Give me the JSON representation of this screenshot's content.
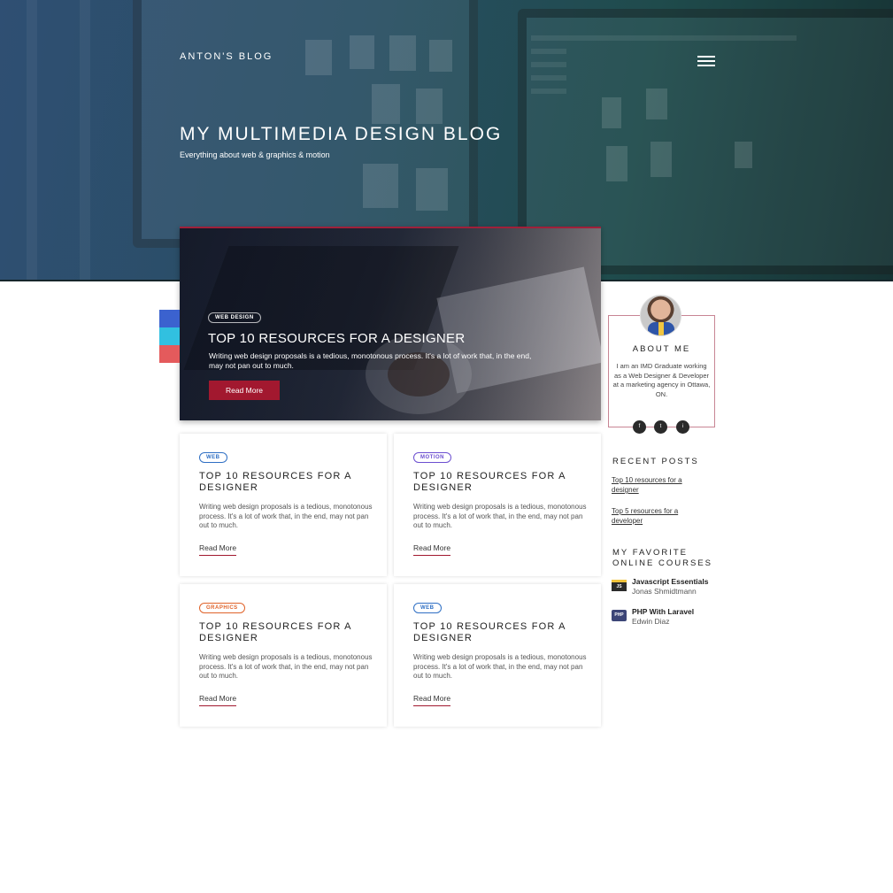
{
  "header": {
    "brand": "ANTON'S BLOG",
    "title": "MY MULTIMEDIA DESIGN BLOG",
    "subtitle": "Everything about web & graphics & motion"
  },
  "featured": {
    "tag": "WEB DESIGN",
    "title": "TOP 10 RESOURCES FOR A DESIGNER",
    "excerpt": "Writing web design proposals is a tedious, monotonous process. It's a lot of work that, in the end, may not pan out to much.",
    "button": "Read More"
  },
  "posts": [
    {
      "tag": "WEB",
      "tag_color": "#2f6fc4",
      "title": "TOP 10 RESOURCES FOR A DESIGNER",
      "excerpt": "Writing web design proposals is a tedious, monotonous process. It's a lot of work that, in the end, may not pan out to much.",
      "link": "Read More"
    },
    {
      "tag": "MOTION",
      "tag_color": "#6c4fd0",
      "title": "TOP 10 RESOURCES FOR A DESIGNER",
      "excerpt": "Writing web design proposals is a tedious, monotonous process. It's a lot of work that, in the end, may not pan out to much.",
      "link": "Read More"
    },
    {
      "tag": "GRAPHICS",
      "tag_color": "#e0632a",
      "title": "TOP 10 RESOURCES FOR A DESIGNER",
      "excerpt": "Writing web design proposals is a tedious, monotonous process. It's a lot of work that, in the end, may not pan out to much.",
      "link": "Read More"
    },
    {
      "tag": "WEB",
      "tag_color": "#2f6fc4",
      "title": "TOP 10 RESOURCES FOR A DESIGNER",
      "excerpt": "Writing web design proposals is a tedious, monotonous process. It's a lot of work that, in the end, may not pan out to much.",
      "link": "Read More"
    }
  ],
  "share": [
    {
      "icon": "facebook-icon",
      "color": "#3b62cf"
    },
    {
      "icon": "twitter-icon",
      "color": "#31c0e0"
    },
    {
      "icon": "pinterest-icon",
      "color": "#e45a5c"
    }
  ],
  "about": {
    "title": "ABOUT ME",
    "text": "I am an IMD Graduate working as a Web Designer & Developer at a marketing agency in Ottawa, ON.",
    "social": [
      "f",
      "t",
      "i"
    ]
  },
  "recent": {
    "title": "RECENT POSTS",
    "links": [
      "Top 10 resources for a designer",
      "Top 5 resources for a developer"
    ]
  },
  "courses": {
    "title": "MY FAVORITE ONLINE COURSES",
    "items": [
      {
        "icon_text": "JS",
        "name": "Javascript Essentials",
        "author": "Jonas Shmidtmann"
      },
      {
        "icon_text": "PHP",
        "name": "PHP With Laravel",
        "author": "Edwin Diaz"
      }
    ]
  },
  "colors": {
    "accent": "#a2182f",
    "hero_start": "#2f4f73",
    "hero_end": "#163233"
  }
}
